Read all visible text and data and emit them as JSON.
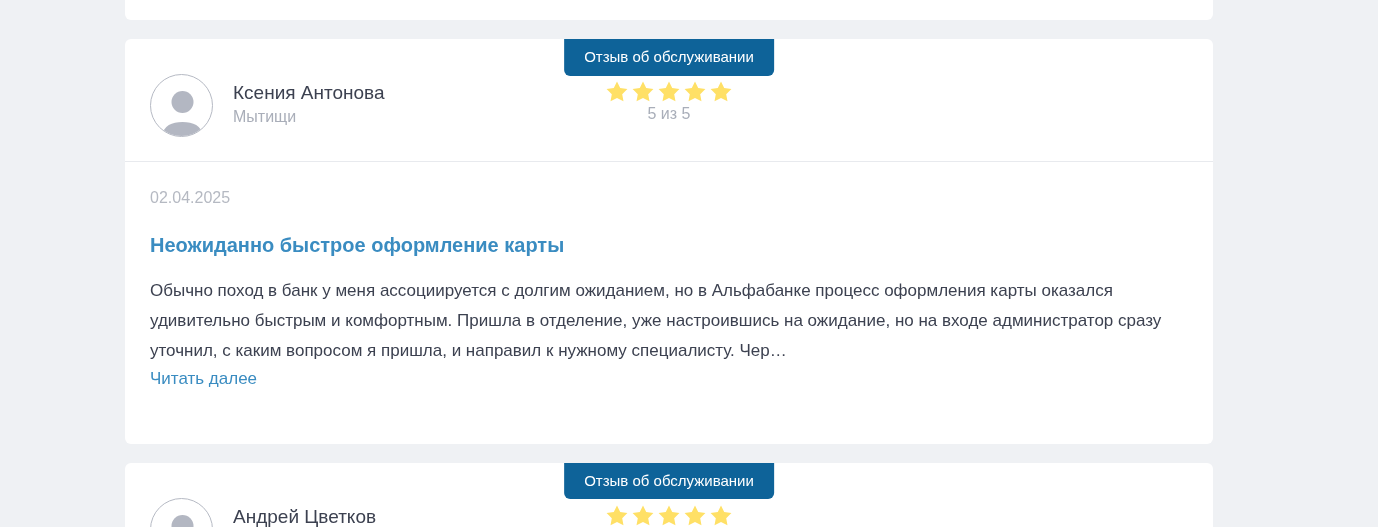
{
  "reviews": [
    {
      "tag": "Отзыв об обслуживании",
      "author": "Ксения Антонова",
      "city": "Мытищи",
      "stars": 5,
      "rating_text": "5 из 5",
      "date": "02.04.2025",
      "title": "Неожиданно быстрое оформление карты",
      "text": "Обычно поход в банк у меня ассоциируется с долгим ожиданием, но в Альфабанке процесс оформления карты оказался удивительно быстрым и комфортным. Пришла в отделение, уже настроившись на ожидание, но на входе администратор сразу уточнил, с каким вопросом я пришла, и направил к нужному специалисту. Чер…",
      "read_more": "Читать далее"
    },
    {
      "tag": "Отзыв об обслуживании",
      "author": "Андрей Цветков",
      "stars": 5
    }
  ]
}
